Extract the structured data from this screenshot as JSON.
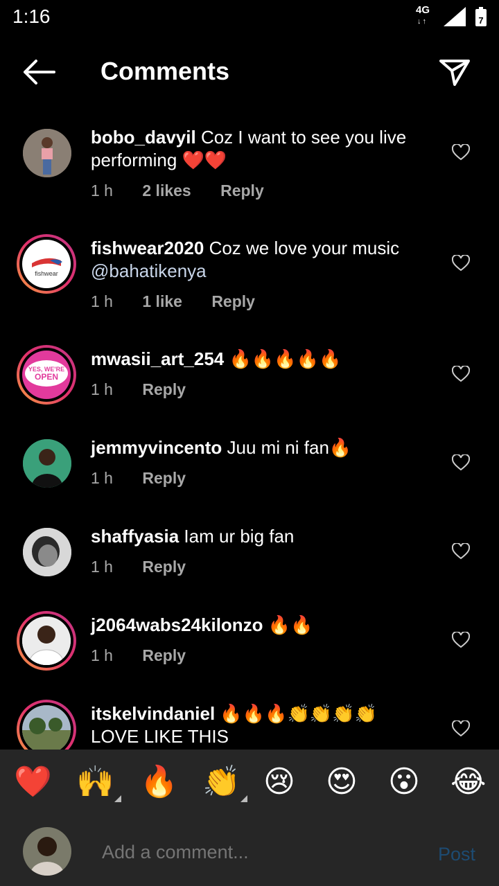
{
  "status": {
    "time": "1:16",
    "network": "4G",
    "network_arrows": "↓↑",
    "battery_level": "7"
  },
  "header": {
    "title": "Comments",
    "back_icon": "back-arrow-icon",
    "send_icon": "send-icon"
  },
  "comments": [
    {
      "username": "bobo_davyil",
      "text": "Coz I want to see you live performing ❤️❤️",
      "time": "1 h",
      "likes": "2 likes",
      "reply": "Reply",
      "has_story_ring": false
    },
    {
      "username": "fishwear2020",
      "text": "Coz we love your music ",
      "mention": "@bahatikenya",
      "time": "1 h",
      "likes": "1 like",
      "reply": "Reply",
      "has_story_ring": true,
      "avatar_brand": "fishwear"
    },
    {
      "username": "mwasii_art_254",
      "text": "🔥🔥🔥🔥🔥",
      "time": "1 h",
      "likes": "",
      "reply": "Reply",
      "has_story_ring": true,
      "avatar_text": "YES, WE'RE OPEN"
    },
    {
      "username": "jemmyvincento",
      "text": "Juu mi ni fan🔥",
      "time": "1 h",
      "likes": "",
      "reply": "Reply",
      "has_story_ring": false
    },
    {
      "username": "shaffyasia",
      "text": "Iam ur big fan",
      "time": "1 h",
      "likes": "",
      "reply": "Reply",
      "has_story_ring": false
    },
    {
      "username": "j2064wabs24kilonzo",
      "text": "🔥🔥",
      "time": "1 h",
      "likes": "",
      "reply": "Reply",
      "has_story_ring": true
    },
    {
      "username": "itskelvindaniel",
      "text": "🔥🔥🔥👏👏👏👏 LOVE LIKE THIS",
      "time": "",
      "likes": "",
      "reply": "",
      "has_story_ring": true
    }
  ],
  "reactions": [
    "❤️",
    "🙌",
    "🔥",
    "👏",
    "😢",
    "😍",
    "😮",
    "😂"
  ],
  "compose": {
    "placeholder": "Add a comment...",
    "post_label": "Post"
  },
  "colors": {
    "background": "#000000",
    "bar": "#262626",
    "post_disabled": "#1d4b72",
    "story_ring": "#e1306c"
  }
}
